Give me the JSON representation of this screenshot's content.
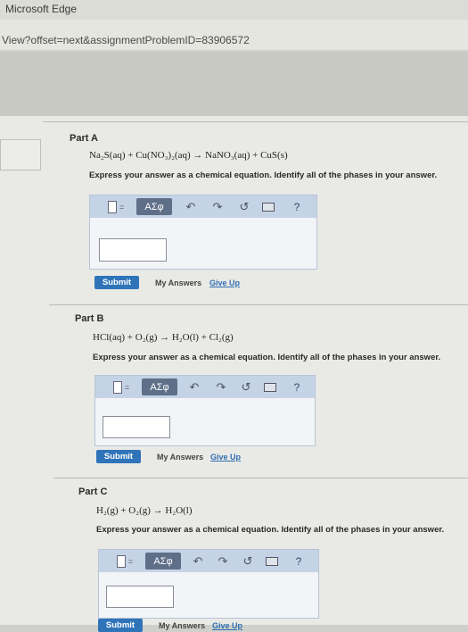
{
  "browser": {
    "app_title": "Microsoft Edge",
    "url_fragment": "View?offset=next&assignmentProblemID=83906572"
  },
  "toolbar": {
    "greek_label": "ΑΣφ",
    "undo_glyph": "↶",
    "redo_glyph": "↷",
    "reset_glyph": "↺",
    "help_glyph": "?"
  },
  "parts": [
    {
      "label": "Part A",
      "equation": "Na₂S(aq) + Cu(NO₃)₂(aq) → NaNO₃(aq) + CuS(s)",
      "instruction": "Express your answer as a chemical equation. Identify all of the phases in your answer.",
      "submit_label": "Submit",
      "my_answers_label": "My Answers",
      "give_up_label": "Give Up",
      "answer_value": ""
    },
    {
      "label": "Part B",
      "equation": "HCl(aq) + O₂(g) → H₂O(l) + Cl₂(g)",
      "instruction": "Express your answer as a chemical equation. Identify all of the phases in your answer.",
      "submit_label": "Submit",
      "my_answers_label": "My Answers",
      "give_up_label": "Give Up",
      "answer_value": ""
    },
    {
      "label": "Part C",
      "equation": "H₂(g) + O₂(g) → H₂O(l)",
      "instruction": "Express your answer as a chemical equation. Identify all of the phases in your answer.",
      "submit_label": "Submit",
      "my_answers_label": "My Answers",
      "give_up_label": "Give Up",
      "answer_value": ""
    }
  ]
}
